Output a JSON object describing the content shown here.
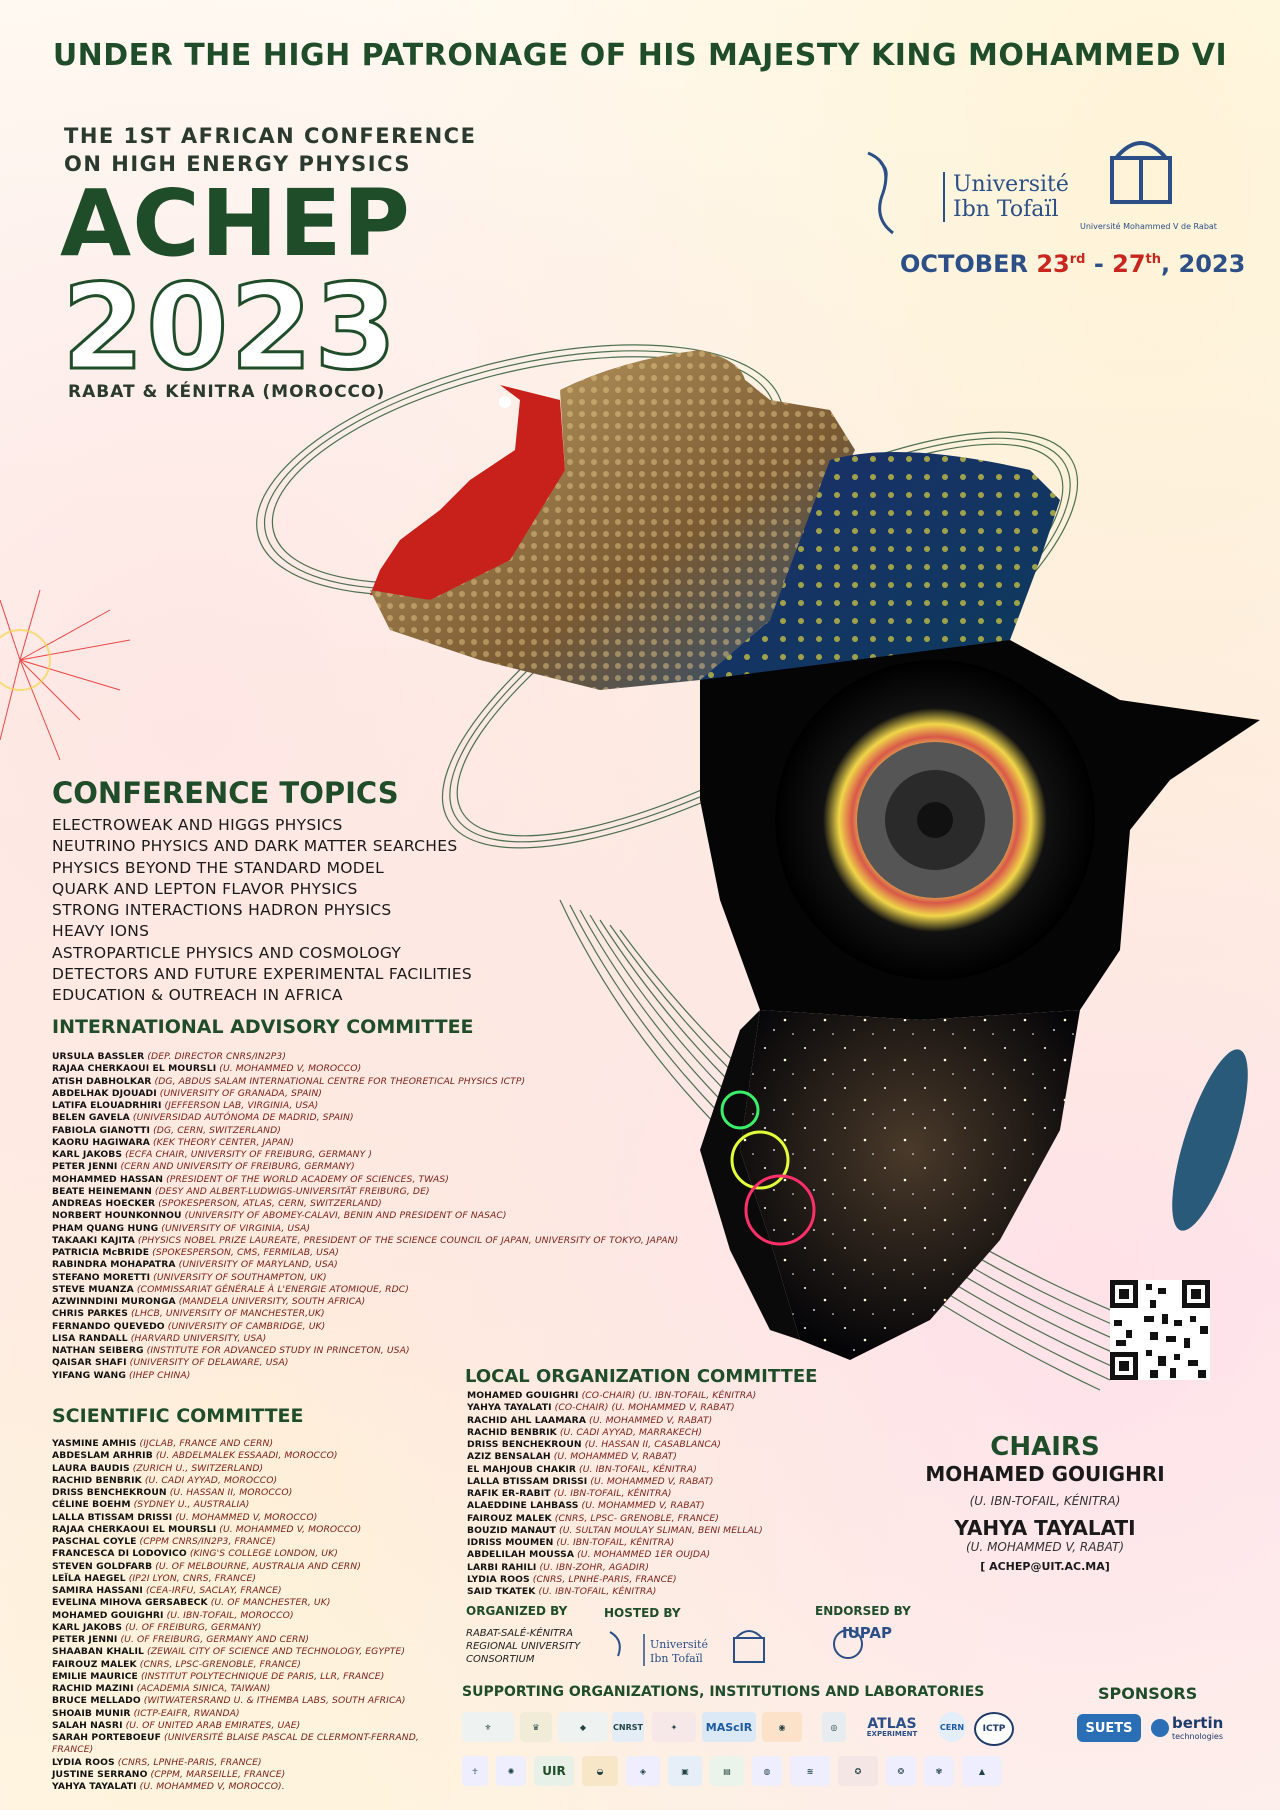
{
  "patronage": "UNDER THE HIGH PATRONAGE OF HIS MAJESTY KING MOHAMMED VI",
  "conference": {
    "line1": "THE 1ST AFRICAN CONFERENCE",
    "line2": "ON HIGH ENERGY PHYSICS",
    "acronym": "ACHEP",
    "year": "2023",
    "location": "RABAT & KÉNITRA  (MOROCCO)"
  },
  "dates": {
    "month": "OCTOBER",
    "start": "23",
    "start_sup": "rd",
    "sep": "-",
    "end": "27",
    "end_sup": "th",
    "year": ", 2023"
  },
  "university": {
    "name1": "Université",
    "name2": "Ibn Tofaïl",
    "small": "Université Ibn Tofaïl",
    "umv": "Université Mohammed V de Rabat"
  },
  "topics": {
    "title": "CONFERENCE TOPICS",
    "items": [
      "ELECTROWEAK AND HIGGS PHYSICS",
      "NEUTRINO PHYSICS AND DARK MATTER SEARCHES",
      "PHYSICS BEYOND THE STANDARD MODEL",
      "QUARK AND LEPTON FLAVOR PHYSICS",
      "STRONG INTERACTIONS HADRON PHYSICS",
      "HEAVY IONS",
      "ASTROPARTICLE PHYSICS AND COSMOLOGY",
      "DETECTORS AND FUTURE EXPERIMENTAL FACILITIES",
      "EDUCATION & OUTREACH IN AFRICA"
    ]
  },
  "iac": {
    "title": "INTERNATIONAL ADVISORY COMMITTEE",
    "members": [
      {
        "name": "URSULA BASSLER",
        "aff": "(DEP. DIRECTOR CNRS/IN2P3)"
      },
      {
        "name": "RAJAA CHERKAOUI EL MOURSLI",
        "aff": "(U. MOHAMMED V, MOROCCO)"
      },
      {
        "name": "ATISH DABHOLKAR",
        "aff": "(DG, ABDUS SALAM INTERNATIONAL CENTRE FOR THEORETICAL PHYSICS ICTP)"
      },
      {
        "name": "ABDELHAK DJOUADI",
        "aff": "(UNIVERSITY OF GRANADA, SPAIN)"
      },
      {
        "name": "LATIFA ELOUADRHIRI",
        "aff": "(JEFFERSON LAB, VIRGINIA, USA)"
      },
      {
        "name": "BELEN GAVELA",
        "aff": "(UNIVERSIDAD AUTÓNOMA DE MADRID, SPAIN)"
      },
      {
        "name": "FABIOLA GIANOTTI",
        "aff": "(DG, CERN, SWITZERLAND)"
      },
      {
        "name": "KAORU HAGIWARA",
        "aff": "(KEK THEORY CENTER, JAPAN)"
      },
      {
        "name": "KARL JAKOBS",
        "aff": "(ECFA CHAIR, UNIVERSITY OF FREIBURG, GERMANY )"
      },
      {
        "name": "PETER JENNI",
        "aff": "(CERN AND UNIVERSITY OF FREIBURG, GERMANY)"
      },
      {
        "name": "MOHAMMED HASSAN",
        "aff": "(PRESIDENT OF THE WORLD ACADEMY OF SCIENCES, TWAS)"
      },
      {
        "name": "BEATE HEINEMANN",
        "aff": "(DESY AND ALBERT-LUDWIGS-UNIVERSITÄT FREIBURG, DE)"
      },
      {
        "name": "ANDREAS HOECKER",
        "aff": "(SPOKESPERSON, ATLAS, CERN, SWITZERLAND)"
      },
      {
        "name": "NORBERT HOUNKONNOU",
        "aff": "(UNIVERSITY OF ABOMEY-CALAVI, BENIN AND PRESIDENT OF NASAC)"
      },
      {
        "name": "PHAM QUANG HUNG",
        "aff": "(UNIVERSITY OF VIRGINIA, USA)"
      },
      {
        "name": "TAKAAKI KAJITA",
        "aff": "(PHYSICS NOBEL PRIZE LAUREATE, PRESIDENT OF THE SCIENCE COUNCIL OF JAPAN, UNIVERSITY OF TOKYO, JAPAN)"
      },
      {
        "name": "PATRICIA McBRIDE",
        "aff": "(SPOKESPERSON, CMS, FERMILAB, USA)"
      },
      {
        "name": "RABINDRA MOHAPATRA",
        "aff": "(UNIVERSITY OF MARYLAND, USA)"
      },
      {
        "name": "STEFANO MORETTI",
        "aff": "(UNIVERSITY OF SOUTHAMPTON, UK)"
      },
      {
        "name": "STEVE MUANZA",
        "aff": "(COMMISSARIAT GÉNÉRALE À L'ENERGIE ATOMIQUE, RDC)"
      },
      {
        "name": "AZWINNDINI MURONGA",
        "aff": "(MANDELA UNIVERSITY, SOUTH AFRICA)"
      },
      {
        "name": "CHRIS PARKES",
        "aff": "(LHCB, UNIVERSITY OF MANCHESTER,UK)"
      },
      {
        "name": "FERNANDO QUEVEDO",
        "aff": "(UNIVERSITY OF CAMBRIDGE, UK)"
      },
      {
        "name": "LISA RANDALL",
        "aff": "(HARVARD UNIVERSITY, USA)"
      },
      {
        "name": "NATHAN SEIBERG",
        "aff": "(INSTITUTE FOR ADVANCED STUDY IN PRINCETON, USA)"
      },
      {
        "name": "QAISAR SHAFI",
        "aff": "(UNIVERSITY OF DELAWARE, USA)"
      },
      {
        "name": "YIFANG WANG",
        "aff": "(IHEP CHINA)"
      }
    ]
  },
  "sc": {
    "title": "SCIENTIFIC COMMITTEE",
    "members": [
      {
        "name": "YASMINE AMHIS",
        "aff": "(IJCLAB, FRANCE AND CERN)"
      },
      {
        "name": "ABDESLAM ARHRIB",
        "aff": "(U. ABDELMALEK ESSAADI, MOROCCO)"
      },
      {
        "name": "LAURA BAUDIS",
        "aff": "(ZURICH U., SWITZERLAND)"
      },
      {
        "name": "RACHID BENBRIK",
        "aff": "(U. CADI AYYAD, MOROCCO)"
      },
      {
        "name": "DRISS BENCHEKROUN",
        "aff": "(U. HASSAN II, MOROCCO)"
      },
      {
        "name": "CÉLINE BOEHM",
        "aff": "(SYDNEY U., AUSTRALIA)"
      },
      {
        "name": "LALLA BTISSAM DRISSI",
        "aff": "(U. MOHAMMED V, MOROCCO)"
      },
      {
        "name": "RAJAA CHERKAOUI EL MOURSLI",
        "aff": "(U. MOHAMMED V, MOROCCO)"
      },
      {
        "name": "PASCHAL COYLE",
        "aff": "(CPPM CNRS/IN2P3, FRANCE)"
      },
      {
        "name": "FRANCESCA DI LODOVICO",
        "aff": "(KING'S COLLEGE LONDON, UK)"
      },
      {
        "name": "STEVEN GOLDFARB",
        "aff": "(U. OF MELBOURNE, AUSTRALIA AND CERN)"
      },
      {
        "name": "LEÏLA HAEGEL",
        "aff": "(IP2I LYON, CNRS, FRANCE)"
      },
      {
        "name": "SAMIRA HASSANI",
        "aff": "(CEA-IRFU, SACLAY, FRANCE)"
      },
      {
        "name": "EVELINA MIHOVA GERSABECK",
        "aff": "(U. OF MANCHESTER, UK)"
      },
      {
        "name": "MOHAMED GOUIGHRI",
        "aff": "(U. IBN-TOFAIL, MOROCCO)"
      },
      {
        "name": "KARL JAKOBS",
        "aff": "(U. OF FREIBURG, GERMANY)"
      },
      {
        "name": "PETER JENNI",
        "aff": "(U. OF FREIBURG, GERMANY AND CERN)"
      },
      {
        "name": "SHAABAN KHALIL",
        "aff": "(ZEWAIL CITY OF SCIENCE AND TECHNOLOGY, EGYPTE)"
      },
      {
        "name": "FAIROUZ MALEK",
        "aff": "(CNRS, LPSC-GRENOBLE, FRANCE)"
      },
      {
        "name": "EMILIE MAURICE",
        "aff": "(INSTITUT POLYTECHNIQUE DE PARIS, LLR, FRANCE)"
      },
      {
        "name": "RACHID MAZINI",
        "aff": "(ACADEMIA SINICA, TAIWAN)"
      },
      {
        "name": "BRUCE MELLADO",
        "aff": "(WITWATERSRAND U. & ITHEMBA LABS, SOUTH AFRICA)"
      },
      {
        "name": "SHOAIB MUNIR",
        "aff": "(ICTP-EAIFR, RWANDA)"
      },
      {
        "name": "SALAH NASRI",
        "aff": "(U. OF UNITED ARAB EMIRATES, UAE)"
      },
      {
        "name": "SARAH PORTEBOEUF",
        "aff": "(UNIVERSITÉ BLAISE PASCAL DE CLERMONT-FERRAND, FRANCE)"
      },
      {
        "name": "LYDIA ROOS",
        "aff": "(CNRS, LPNHE-PARIS, FRANCE)"
      },
      {
        "name": "JUSTINE SERRANO",
        "aff": "(CPPM, MARSEILLE, FRANCE)"
      },
      {
        "name": "YAHYA TAYALATI",
        "aff": "(U. MOHAMMED V, MOROCCO)."
      }
    ]
  },
  "loc": {
    "title": "LOCAL ORGANIZATION COMMITTEE",
    "members": [
      {
        "name": "MOHAMED GOUIGHRI",
        "aff": "(CO-CHAIR) (U. IBN-TOFAIL, KÉNITRA)"
      },
      {
        "name": "YAHYA TAYALATI",
        "aff": "(CO-CHAIR) (U. MOHAMMED V, RABAT)"
      },
      {
        "name": "RACHID AHL LAAMARA",
        "aff": "(U. MOHAMMED V, RABAT)"
      },
      {
        "name": "RACHID BENBRIK",
        "aff": "(U. CADI AYYAD, MARRAKECH)"
      },
      {
        "name": "DRISS BENCHEKROUN",
        "aff": "(U. HASSAN II, CASABLANCA)"
      },
      {
        "name": "AZIZ BENSALAH",
        "aff": "(U. MOHAMMED V, RABAT)"
      },
      {
        "name": "EL MAHJOUB CHAKIR",
        "aff": "(U. IBN-TOFAIL, KÉNITRA)"
      },
      {
        "name": "LALLA BTISSAM DRISSI",
        "aff": "(U. MOHAMMED V, RABAT)"
      },
      {
        "name": "RAFIK ER-RABIT",
        "aff": "(U. IBN-TOFAIL, KÉNITRA)"
      },
      {
        "name": "ALAEDDINE LAHBASS",
        "aff": "(U. MOHAMMED V, RABAT)"
      },
      {
        "name": "FAIROUZ MALEK",
        "aff": "(CNRS, LPSC- GRENOBLE, FRANCE)"
      },
      {
        "name": "BOUZID MANAUT",
        "aff": "(U. SULTAN MOULAY SLIMAN, BENI MELLAL)"
      },
      {
        "name": "IDRISS MOUMEN",
        "aff": "(U. IBN-TOFAIL, KÉNITRA)"
      },
      {
        "name": "ABDELILAH MOUSSA",
        "aff": "(U. MOHAMMED 1ER OUJDA)"
      },
      {
        "name": "LARBI RAHILI",
        "aff": "(U. IBN-ZOHR, AGADIR)"
      },
      {
        "name": "LYDIA ROOS",
        "aff": "(CNRS, LPNHE-PARIS, FRANCE)"
      },
      {
        "name": "SAID TKATEK",
        "aff": "(U. IBN-TOFAIL, KÉNITRA)"
      }
    ]
  },
  "chairs": {
    "title": "CHAIRS",
    "c1_name": "MOHAMED GOUIGHRI",
    "c1_aff": "(U. IBN-TOFAIL, KÉNITRA)",
    "c2_name": "YAHYA TAYALATI",
    "c2_aff": "(U. MOHAMMED V, RABAT)",
    "email": "[ ACHEP@UIT.AC.MA]"
  },
  "footer": {
    "organized_by": "ORGANIZED BY",
    "consortium": "RABAT-SALÉ-KÉNITRA REGIONAL UNIVERSITY CONSORTIUM",
    "hosted_by": "HOSTED BY",
    "endorsed_by": "ENDORSED BY",
    "iupap": "IUPAP",
    "supporting": "SUPPORTING ORGANIZATIONS, INSTITUTIONS AND LABORATORIES",
    "sponsors": "SPONSORS",
    "sponsor1": "SUETS",
    "sponsor2": "bertin",
    "sponsor2_sub": "technologies",
    "atlas": "ATLAS",
    "atlas_sub": "EXPERIMENT",
    "ictp": "ICTP",
    "cern": "CERN",
    "ur": "UR",
    "uir": "UIR",
    "mascir": "MAScIR",
    "cnrst": "CNRST"
  },
  "colors": {
    "green": "#1f4d2a",
    "navy": "#2b4f86",
    "red": "#c8261e"
  }
}
